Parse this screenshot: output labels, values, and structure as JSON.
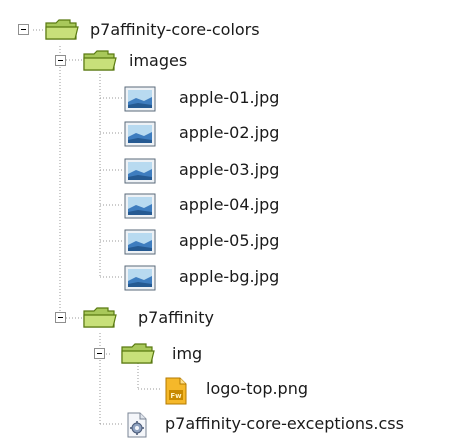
{
  "tree": {
    "root": {
      "label": "p7affinity-core-colors",
      "icon": "folder-open-icon",
      "expanded": true
    },
    "images": {
      "label": "images",
      "icon": "folder-open-icon",
      "expanded": true,
      "files": [
        {
          "label": "apple-01.jpg",
          "icon": "image-file-icon"
        },
        {
          "label": "apple-02.jpg",
          "icon": "image-file-icon"
        },
        {
          "label": "apple-03.jpg",
          "icon": "image-file-icon"
        },
        {
          "label": "apple-04.jpg",
          "icon": "image-file-icon"
        },
        {
          "label": "apple-05.jpg",
          "icon": "image-file-icon"
        },
        {
          "label": "apple-bg.jpg",
          "icon": "image-file-icon"
        }
      ]
    },
    "p7affinity": {
      "label": "p7affinity",
      "icon": "folder-open-icon",
      "expanded": true
    },
    "img": {
      "label": "img",
      "icon": "folder-open-icon",
      "expanded": true,
      "files": [
        {
          "label": "logo-top.png",
          "icon": "fireworks-png-icon"
        }
      ]
    },
    "css_file": {
      "label": "p7affinity-core-exceptions.css",
      "icon": "css-gear-file-icon"
    }
  },
  "colors": {
    "folder_fill": "#c8e07a",
    "folder_stroke": "#5a7a12",
    "connector": "#9a9a9a"
  }
}
